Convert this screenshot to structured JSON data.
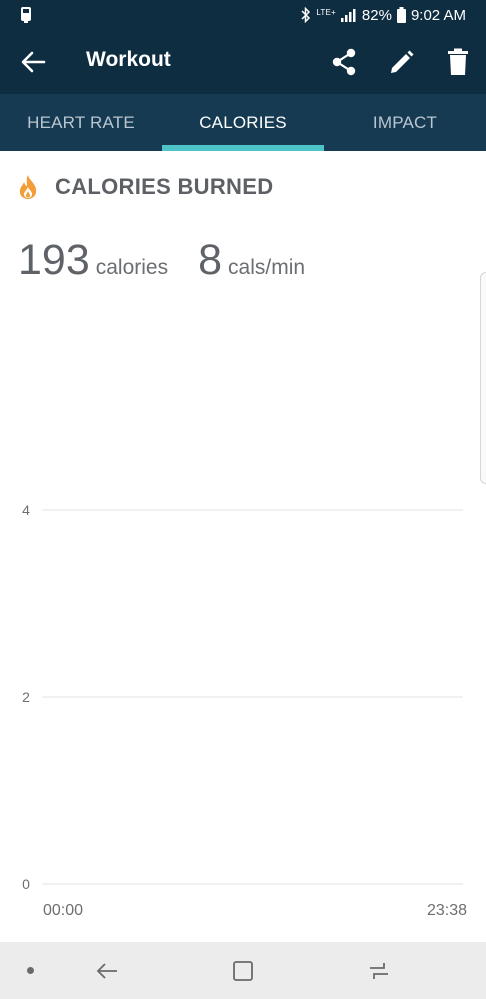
{
  "status_bar": {
    "battery_text": "82%",
    "time": "9:02 AM",
    "network_label": "LTE+",
    "icons": [
      "notification-icon",
      "bluetooth-icon",
      "signal-icon",
      "battery-icon"
    ]
  },
  "app_bar": {
    "title": "Workout",
    "icons": [
      "back-arrow-icon",
      "share-icon",
      "edit-pencil-icon",
      "trash-icon"
    ]
  },
  "tabs": [
    {
      "label": "HEART RATE",
      "active": false
    },
    {
      "label": "CALORIES",
      "active": true
    },
    {
      "label": "IMPACT",
      "active": false
    }
  ],
  "section": {
    "title": "CALORIES BURNED",
    "icon": "flame-icon"
  },
  "stats": {
    "calories_value": "193",
    "calories_unit": "calories",
    "rate_value": "8",
    "rate_unit": "cals/min"
  },
  "chart_data": {
    "type": "line",
    "title": "",
    "xlabel": "",
    "ylabel": "",
    "x_tick_labels": [
      "00:00",
      "23:38"
    ],
    "y_ticks": [
      0,
      2,
      4
    ],
    "ylim": [
      0,
      4
    ],
    "grid": true,
    "series": []
  },
  "colors": {
    "header_bg": "#0f2d41",
    "tab_bg": "#163a52",
    "tab_indicator": "#4ec4c8",
    "flame_orange": "#f29d38",
    "gridline": "#e3e3e3"
  },
  "nav_bar": {
    "icons": [
      "dot-icon",
      "nav-back-icon",
      "home-icon",
      "recent-apps-icon"
    ]
  }
}
